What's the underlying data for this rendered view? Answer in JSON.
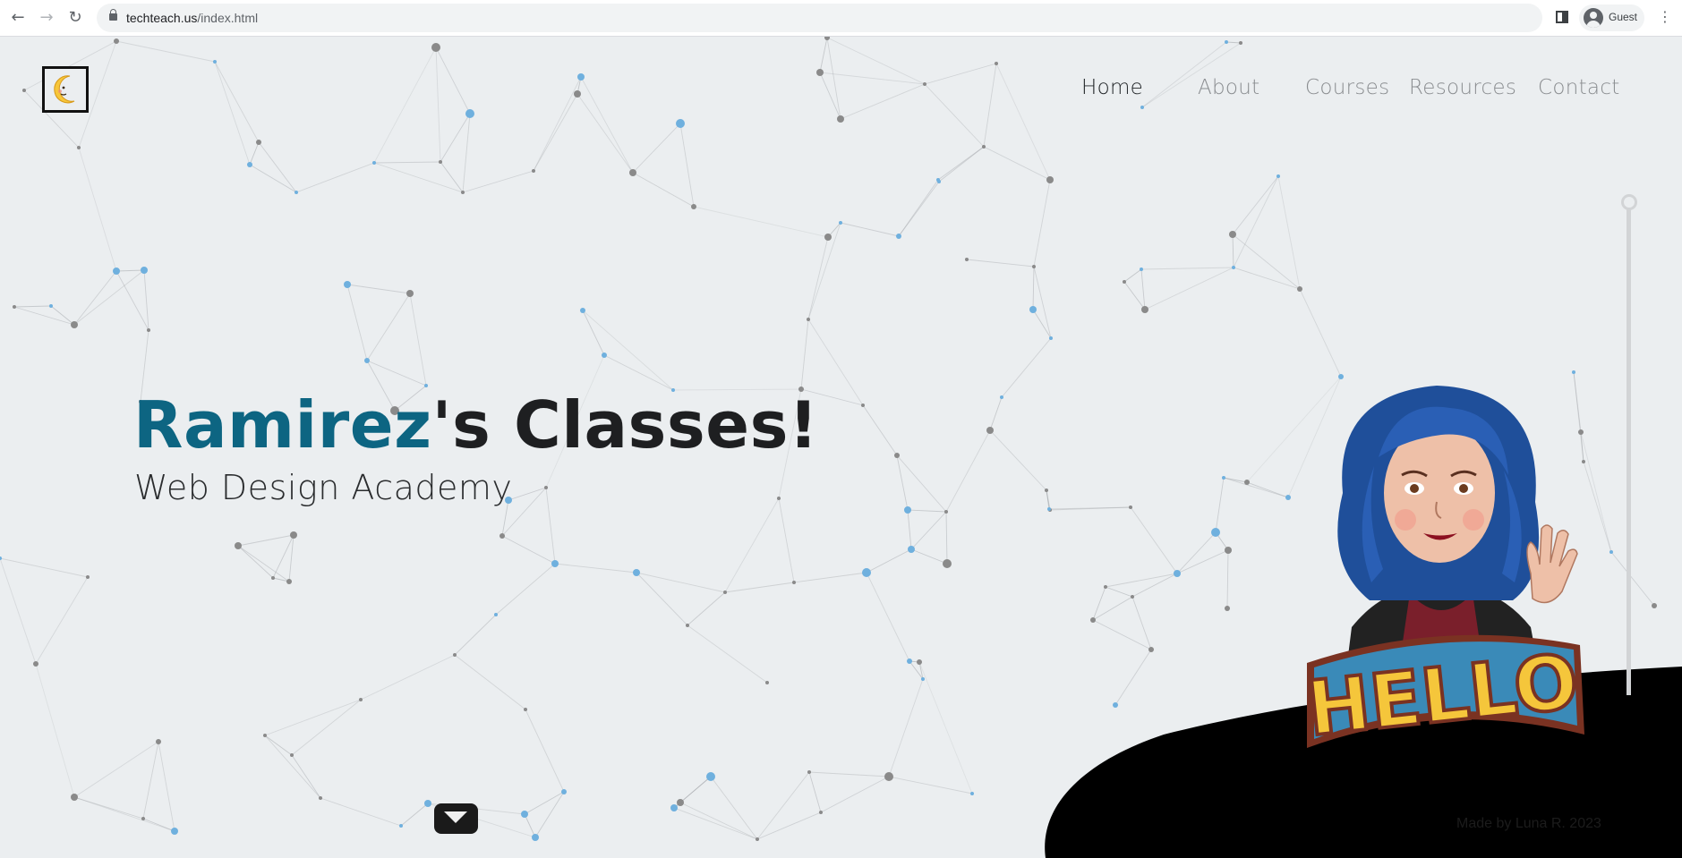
{
  "browser": {
    "url_host": "techteach.us",
    "url_path": "/index.html",
    "profile_name": "Guest"
  },
  "nav": {
    "items": [
      "Home",
      "About",
      "Courses",
      "Resources",
      "Contact"
    ],
    "active": "Home"
  },
  "hero": {
    "title_accent": "Ramirez",
    "title_rest": "'s Classes!",
    "subtitle": "Web Design Academy"
  },
  "avatar": {
    "caption": "HELLO"
  },
  "footer": {
    "credit": "Made by Luna R. 2023"
  },
  "colors": {
    "background": "#ebeef0",
    "accent": "#0d6582",
    "node_blue": "#6fb0de",
    "node_grey": "#8a8a8a",
    "blob": "#000000"
  },
  "icons": {
    "back": "arrow-left-icon",
    "forward": "arrow-right-icon",
    "reload": "reload-icon",
    "lock": "lock-icon",
    "side_panel": "side-panel-icon",
    "menu": "kebab-menu-icon",
    "mail": "mail-icon",
    "logo": "crescent-moon-icon"
  }
}
